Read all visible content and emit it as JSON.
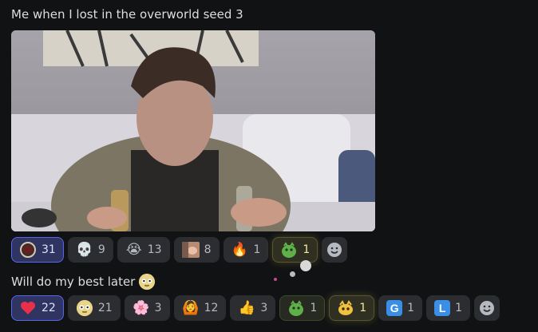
{
  "message1": {
    "text": "Me when I lost in the overworld seed 3"
  },
  "reactions_row1": [
    {
      "emoji": "custom-portal-emoji",
      "count": "31",
      "me": true
    },
    {
      "emoji": "💀",
      "count": "9"
    },
    {
      "emoji": "😭",
      "count": "13"
    },
    {
      "emoji": "custom-photo-emoji",
      "count": "8"
    },
    {
      "emoji": "🔥",
      "count": "1"
    },
    {
      "emoji": "custom-green-creature-emoji",
      "count": "1",
      "glow": true
    }
  ],
  "message2": {
    "text": "Will do my best later"
  },
  "reactions_row2": [
    {
      "emoji": "❤️",
      "count": "22",
      "me": true
    },
    {
      "emoji": "custom-face-emoji",
      "count": "21"
    },
    {
      "emoji": "🌸",
      "count": "3"
    },
    {
      "emoji": "🙆",
      "count": "12"
    },
    {
      "emoji": "👍",
      "count": "3"
    },
    {
      "emoji": "custom-green-creature-emoji",
      "count": "1"
    },
    {
      "emoji": "custom-glowing-creature-emoji",
      "count": "1",
      "glow": true
    },
    {
      "emoji": "G",
      "count": "1"
    },
    {
      "emoji": "L",
      "count": "1"
    }
  ],
  "colors": {
    "background": "#111214",
    "pill": "#2b2d31",
    "accent": "#5865f2"
  }
}
